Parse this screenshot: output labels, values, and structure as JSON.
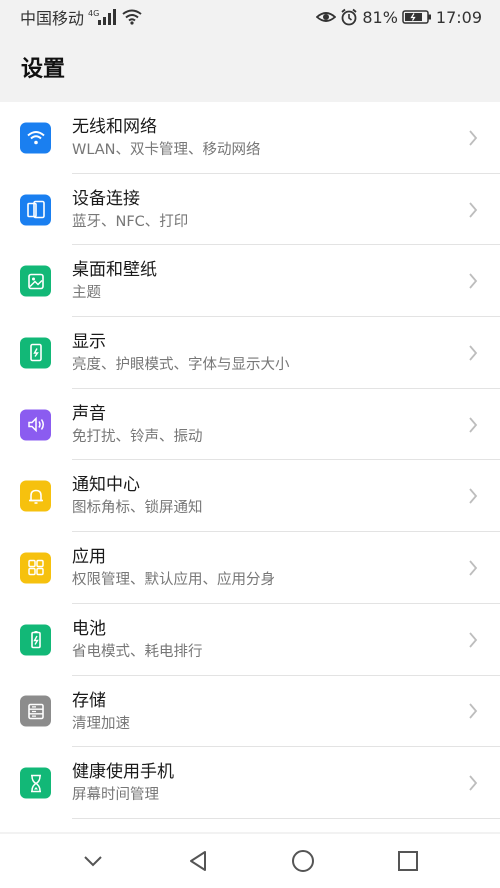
{
  "status_bar": {
    "carrier": "中国移动",
    "network_type": "4G",
    "battery_percent": "81%",
    "time": "17:09",
    "icons": [
      "signal-icon",
      "wifi-icon",
      "eye-comfort-icon",
      "alarm-icon",
      "battery-icon"
    ]
  },
  "header": {
    "title": "设置"
  },
  "settings_items": [
    {
      "title": "无线和网络",
      "subtitle": "WLAN、双卡管理、移动网络",
      "icon": "wifi-icon",
      "color": "#1a7ff0"
    },
    {
      "title": "设备连接",
      "subtitle": "蓝牙、NFC、打印",
      "icon": "device-connection-icon",
      "color": "#1a7ff0"
    },
    {
      "title": "桌面和壁纸",
      "subtitle": "主题",
      "icon": "wallpaper-icon",
      "color": "#12b877"
    },
    {
      "title": "显示",
      "subtitle": "亮度、护眼模式、字体与显示大小",
      "icon": "display-icon",
      "color": "#12b877"
    },
    {
      "title": "声音",
      "subtitle": "免打扰、铃声、振动",
      "icon": "sound-icon",
      "color": "#8b5cf0"
    },
    {
      "title": "通知中心",
      "subtitle": "图标角标、锁屏通知",
      "icon": "notification-bell-icon",
      "color": "#f6c10e"
    },
    {
      "title": "应用",
      "subtitle": "权限管理、默认应用、应用分身",
      "icon": "apps-grid-icon",
      "color": "#f6c10e"
    },
    {
      "title": "电池",
      "subtitle": "省电模式、耗电排行",
      "icon": "battery-icon",
      "color": "#12b877"
    },
    {
      "title": "存储",
      "subtitle": "清理加速",
      "icon": "storage-icon",
      "color": "#8c8c8c"
    },
    {
      "title": "健康使用手机",
      "subtitle": "屏幕时间管理",
      "icon": "hourglass-icon",
      "color": "#12b877"
    }
  ],
  "nav_bar": {
    "buttons": [
      "collapse-chevron-icon",
      "back-triangle-icon",
      "home-circle-icon",
      "recents-square-icon"
    ]
  }
}
